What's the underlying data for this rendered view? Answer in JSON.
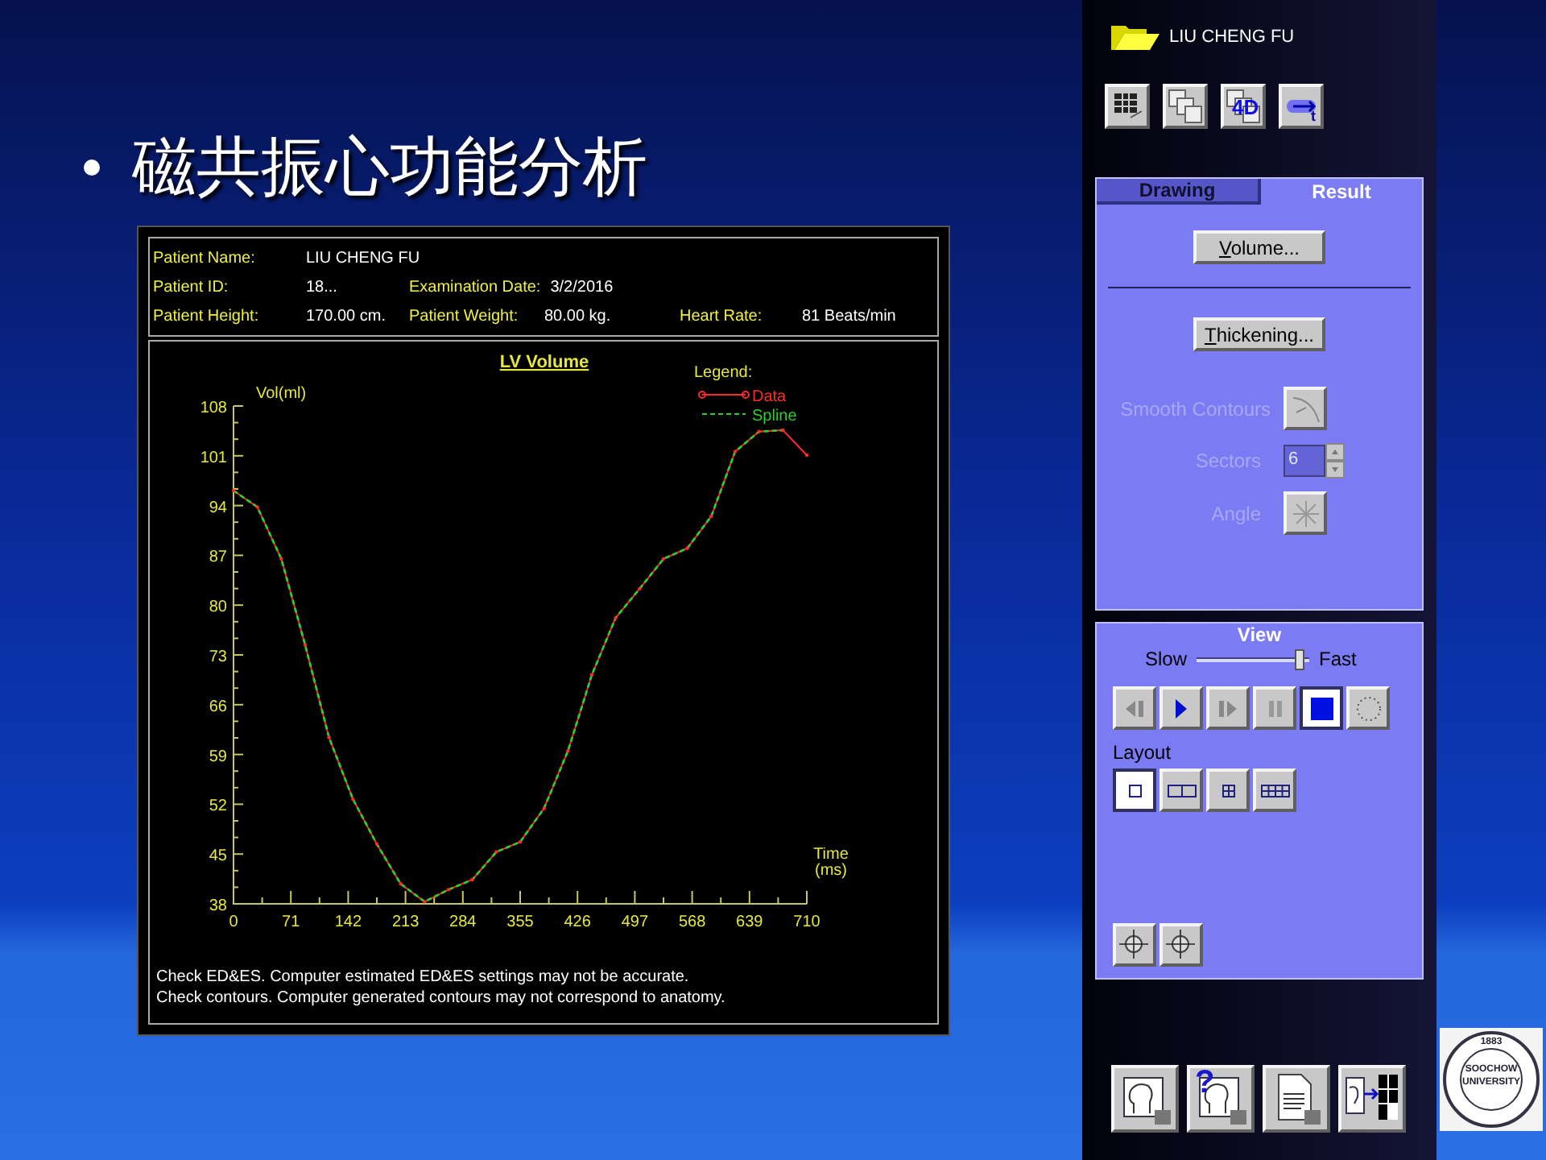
{
  "slide": {
    "title": "磁共振心功能分析"
  },
  "report": {
    "patient_rows": [
      [
        {
          "label": "Patient Name:",
          "value": "LIU CHENG FU"
        }
      ],
      [
        {
          "label": "Patient ID:",
          "value": "18..."
        },
        {
          "label": "Examination Date:",
          "value": "3/2/2016"
        }
      ],
      [
        {
          "label": "Patient Height:",
          "value": "170.00 cm."
        },
        {
          "label": "Patient Weight:",
          "value": "80.00 kg."
        },
        {
          "label": "Heart Rate:",
          "value": "81 Beats/min"
        }
      ]
    ],
    "chart_data": {
      "type": "line",
      "title": "LV Volume",
      "xlabel": "Time (ms)",
      "ylabel": "Vol(ml)",
      "legend": {
        "title": "Legend:"
      },
      "x": [
        0,
        29.6,
        59.2,
        88.8,
        118.3,
        147.9,
        177.5,
        207.1,
        236.7,
        266.3,
        295.8,
        325.4,
        355,
        384.6,
        414.2,
        443.8,
        473.3,
        502.9,
        532.5,
        562.1,
        591.7,
        621.3,
        650.8,
        680.4,
        710
      ],
      "series": [
        {
          "name": "Data",
          "color": "#ff2a2a",
          "line_style": "solid",
          "values": [
            96.1,
            93.8,
            86.5,
            74.4,
            61.4,
            52.7,
            46.4,
            40.8,
            38.3,
            40.0,
            41.4,
            45.3,
            46.7,
            51.4,
            59.5,
            70.2,
            78.2,
            82.3,
            86.5,
            88.0,
            92.5,
            101.6,
            104.4,
            104.6,
            101.1
          ]
        },
        {
          "name": "Spline",
          "color": "#2ad02a",
          "line_style": "dashed",
          "values": [
            96.1,
            93.8,
            86.5,
            74.4,
            61.4,
            52.7,
            46.4,
            40.8,
            38.3,
            40.0,
            41.4,
            45.3,
            46.7,
            51.4,
            59.5,
            70.2,
            78.2,
            82.3,
            86.5,
            88.0,
            92.5,
            101.6,
            104.4,
            104.6,
            null
          ]
        }
      ],
      "xlim": [
        0,
        710
      ],
      "ylim": [
        38,
        108
      ],
      "xticks": [
        0,
        71,
        142,
        213,
        284,
        355,
        426,
        497,
        568,
        639,
        710
      ],
      "yticks": [
        38,
        45,
        52,
        59,
        66,
        73,
        80,
        87,
        94,
        101,
        108
      ]
    },
    "notes": [
      "Check ED&ES. Computer estimated ED&ES settings may not be accurate.",
      "Check contours. Computer generated contours may not correspond to anatomy."
    ]
  },
  "side_panel": {
    "patient_name": "LIU CHENG FU",
    "tools": [
      {
        "kind": "grid"
      },
      {
        "kind": "series"
      },
      {
        "kind": "fourd",
        "label": "4D"
      },
      {
        "kind": "time",
        "label": "t"
      }
    ],
    "tabs": [
      {
        "label": "Drawing",
        "selected": false
      },
      {
        "label": "Result",
        "selected": true
      }
    ],
    "result_buttons": [
      {
        "label": "Volume..."
      },
      {
        "label": "Thickening..."
      }
    ],
    "options": [
      {
        "kind": "button",
        "label": "Smooth Contours",
        "disabled": true
      },
      {
        "kind": "spinner",
        "label": "Sectors",
        "value": "6",
        "disabled": true
      },
      {
        "kind": "angle",
        "label": "Angle",
        "disabled": true
      }
    ],
    "view": {
      "title": "View",
      "speed": {
        "min_label": "Slow",
        "max_label": "Fast",
        "level": 0.95
      },
      "playback": [
        {
          "kind": "step-back",
          "selected": false
        },
        {
          "kind": "play",
          "selected": false
        },
        {
          "kind": "step-forward",
          "selected": false
        },
        {
          "kind": "pause",
          "selected": false
        },
        {
          "kind": "stop",
          "selected": true
        },
        {
          "kind": "loop",
          "selected": false
        }
      ],
      "layout_label": "Layout",
      "layouts": [
        {
          "kind": "single",
          "selected": true
        },
        {
          "kind": "double",
          "selected": false
        },
        {
          "kind": "quad",
          "selected": false
        },
        {
          "kind": "octal",
          "selected": false
        }
      ]
    },
    "bottom_actions": [
      {
        "kind": "save"
      },
      {
        "kind": "help",
        "label": "?"
      },
      {
        "kind": "report"
      },
      {
        "kind": "export"
      }
    ]
  },
  "logo": {
    "year": "1883",
    "name": "SOOCHOW UNIVERSITY"
  }
}
